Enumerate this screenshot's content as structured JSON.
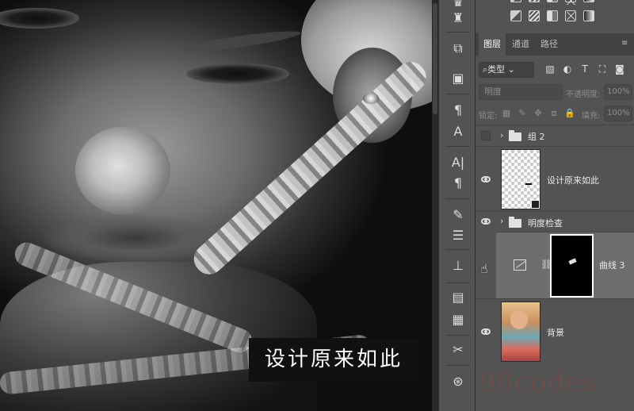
{
  "canvas": {
    "caption": "设计原来如此"
  },
  "panel": {
    "tabs": [
      {
        "label": "图层",
        "active": true
      },
      {
        "label": "通道",
        "active": false
      },
      {
        "label": "路径",
        "active": false
      }
    ],
    "filter": {
      "kind_label": "类型"
    },
    "blend": {
      "mode": "明度",
      "opacity_label": "不透明度:",
      "opacity_value": "100%"
    },
    "lock": {
      "label": "锁定:",
      "fill_label": "填充:",
      "fill_value": "100%"
    },
    "layers": [
      {
        "name": "组 2",
        "type": "group",
        "visible": false,
        "expanded": false
      },
      {
        "name": "设计原来如此",
        "type": "smart-object",
        "visible": true
      },
      {
        "name": "明度检查",
        "type": "group",
        "visible": true,
        "expanded": false
      },
      {
        "name": "曲线 3",
        "type": "adjustment-curves",
        "visible": true,
        "selected": true
      },
      {
        "name": "背景",
        "type": "image",
        "visible": true
      }
    ]
  },
  "toolbar": {
    "icons": [
      "crown-icon",
      "stamp-icon",
      "frame-icon",
      "3d-object-icon",
      "text-style-icon",
      "character-icon",
      "paragraph-icon",
      "brush-settings-icon",
      "adjustments-icon",
      "stamp-tool-icon",
      "page-icon",
      "notes-icon",
      "tools-icon",
      "share-icon"
    ]
  },
  "watermark": "98codes",
  "colors": {
    "panel_bg": "#535353",
    "tab_bar": "#424242",
    "selected_layer": "#6e6e6e",
    "canvas_caption_bg": "#111111"
  }
}
